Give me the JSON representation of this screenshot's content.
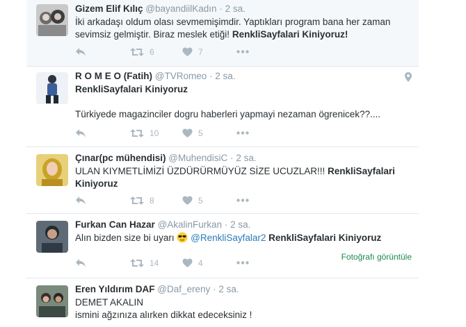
{
  "tweets": [
    {
      "fullname": "Gizem Elif Kılıç",
      "username": "@bayandiilKadın",
      "time": "2 sa.",
      "lines": [
        "İki arkadaşı oldum olası sevmemişimdir. Yaptıkları program bana her zaman",
        "sevimsiz gelmiştir. Biraz meslek etiği!"
      ],
      "hashtag": "RenkliSayfalari Kiniyoruz!",
      "retweets": "6",
      "likes": "7"
    },
    {
      "fullname": "R O M E O (Fatih)",
      "username": "@TVRomeo",
      "time": "2 sa.",
      "hashtag": "RenkliSayfalari Kiniyoruz",
      "body": "Türkiyede magazinciler dogru haberleri yapmayi nezaman ögrenicek??....",
      "retweets": "10",
      "likes": "5",
      "pin_icon": "location-pin-icon"
    },
    {
      "fullname": "Çınar(pc mühendisi)",
      "username": "@MuhendisiC",
      "time": "2 sa.",
      "line1": "ULAN KIYMETLİMİZİ ÜZDÜRÜRMÜYÜZ SİZE UCUZLAR!!!",
      "hashtag1": "RenkliSayfalari",
      "hashtag2": "Kiniyoruz",
      "retweets": "8",
      "likes": "5"
    },
    {
      "fullname": "Furkan Can Hazar",
      "username": "@AkalinFurkan",
      "time": "2 sa.",
      "prefix": "Alın bizden size bi uyarı",
      "mention": "@RenkliSayfalar2",
      "hashtag": "RenkliSayfalari Kiniyoruz",
      "retweets": "14",
      "likes": "4",
      "media_link": "Fotoğrafı görüntüle"
    },
    {
      "fullname": "Eren Yıldırım DAF",
      "username": "@Daf_ereny",
      "time": "2 sa.",
      "lines": [
        "DEMET AKALIN",
        "ismini ağzınıza alırken dikkat edeceksiniz !"
      ]
    }
  ],
  "separator": "·",
  "colors": {
    "meta": "#8899a6",
    "action": "#aab8c2",
    "link": "#2b7bb9",
    "media": "#1b8a4c"
  }
}
